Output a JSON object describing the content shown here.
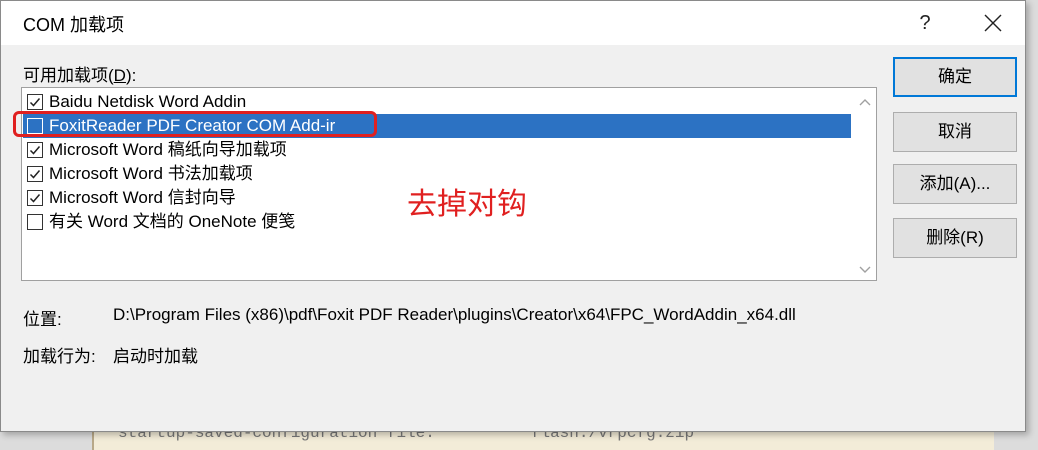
{
  "window": {
    "title": "COM 加载项",
    "help_label": "?"
  },
  "addins": {
    "label_prefix": "可用加载项(",
    "label_key": "D",
    "label_suffix": "):",
    "items": [
      {
        "label": "Baidu Netdisk Word Addin",
        "checked": true,
        "selected": false
      },
      {
        "label": "FoxitReader PDF Creator COM Add-ir",
        "checked": false,
        "selected": true
      },
      {
        "label": "Microsoft Word 稿纸向导加载项",
        "checked": true,
        "selected": false
      },
      {
        "label": "Microsoft Word 书法加载项",
        "checked": true,
        "selected": false
      },
      {
        "label": "Microsoft Word 信封向导",
        "checked": true,
        "selected": false
      },
      {
        "label": "有关 Word 文档的 OneNote 便笺",
        "checked": false,
        "selected": false
      }
    ]
  },
  "annotation": {
    "text": "去掉对钩",
    "color": "#e02020"
  },
  "buttons": {
    "ok": "确定",
    "cancel": "取消",
    "add": "添加(A)...",
    "remove": "删除(R)"
  },
  "details": {
    "location_label": "位置:",
    "location_value": "D:\\Program Files (x86)\\pdf\\Foxit PDF Reader\\plugins\\Creator\\x64\\FPC_WordAddin_x64.dll",
    "load_behavior_label": "加载行为:",
    "load_behavior_value": "启动时加载"
  },
  "background": {
    "text": "startup-saved-configuration file:          flash:/vrpcfg.zip"
  },
  "colors": {
    "selection": "#2c72c3",
    "default_button_border": "#0078d7"
  }
}
